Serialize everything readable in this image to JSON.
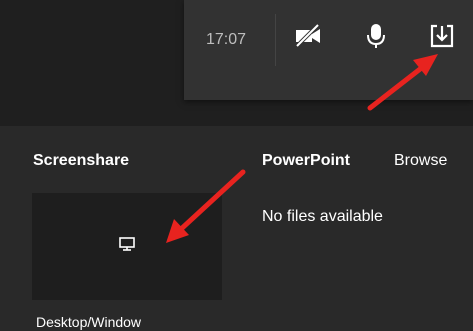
{
  "call_bar": {
    "timer": "17:07",
    "camera_icon": "camera-off-icon",
    "mic_icon": "microphone-icon",
    "share_icon": "share-tray-icon"
  },
  "share_panel": {
    "screenshare_label": "Screenshare",
    "powerpoint_label": "PowerPoint",
    "browse_label": "Browse",
    "no_files_text": "No files available",
    "tile_caption": "Desktop/Window",
    "tile_icon": "monitor-icon"
  },
  "annotation": {
    "arrow_color": "#e8231f"
  },
  "colors": {
    "top_background": "#1f1f1f",
    "panel_background": "#292929",
    "call_bar_background": "#323232",
    "tile_background": "#1e1e1e"
  }
}
